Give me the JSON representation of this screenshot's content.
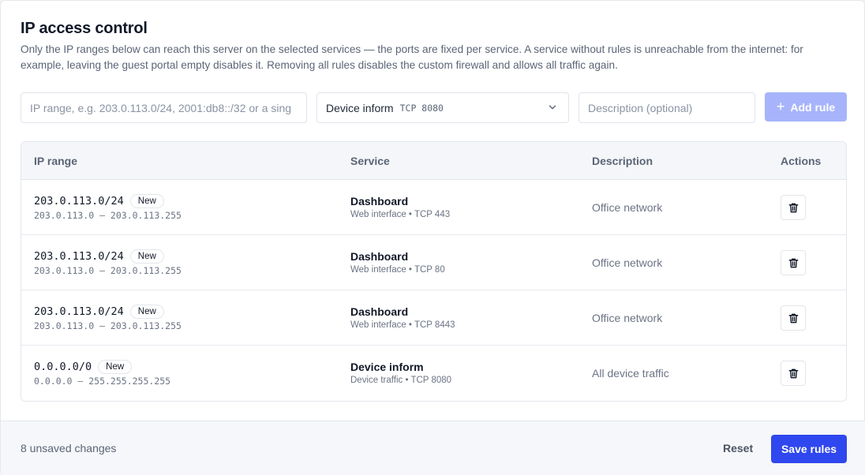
{
  "header": {
    "title": "IP access control",
    "description": "Only the IP ranges below can reach this server on the selected services — the ports are fixed per service. A service without rules is unreachable from the internet: for example, leaving the guest portal empty disables it. Removing all rules disables the custom firewall and allows all traffic again."
  },
  "form": {
    "ip_placeholder": "IP range, e.g. 203.0.113.0/24, 2001:db8::/32 or a sing",
    "service_selected": "Device inform",
    "service_port": "TCP 8080",
    "description_placeholder": "Description (optional)",
    "add_label": "Add rule",
    "add_icon": "plus-icon"
  },
  "table": {
    "columns": [
      "IP range",
      "Service",
      "Description",
      "Actions"
    ],
    "rows": [
      {
        "ip": "203.0.113.0/24",
        "badge": "New",
        "range": "203.0.113.0 – 203.0.113.255",
        "service": "Dashboard",
        "service_detail": "Web interface • TCP 443",
        "description": "Office network"
      },
      {
        "ip": "203.0.113.0/24",
        "badge": "New",
        "range": "203.0.113.0 – 203.0.113.255",
        "service": "Dashboard",
        "service_detail": "Web interface • TCP 80",
        "description": "Office network"
      },
      {
        "ip": "203.0.113.0/24",
        "badge": "New",
        "range": "203.0.113.0 – 203.0.113.255",
        "service": "Dashboard",
        "service_detail": "Web interface • TCP 8443",
        "description": "Office network"
      },
      {
        "ip": "0.0.0.0/0",
        "badge": "New",
        "range": "0.0.0.0 – 255.255.255.255",
        "service": "Device inform",
        "service_detail": "Device traffic • TCP 8080",
        "description": "All device traffic"
      }
    ]
  },
  "footer": {
    "status": "8 unsaved changes",
    "reset_label": "Reset",
    "save_label": "Save rules"
  },
  "colors": {
    "primary": "#2f47ee",
    "primary_disabled": "#a7b4fb"
  }
}
